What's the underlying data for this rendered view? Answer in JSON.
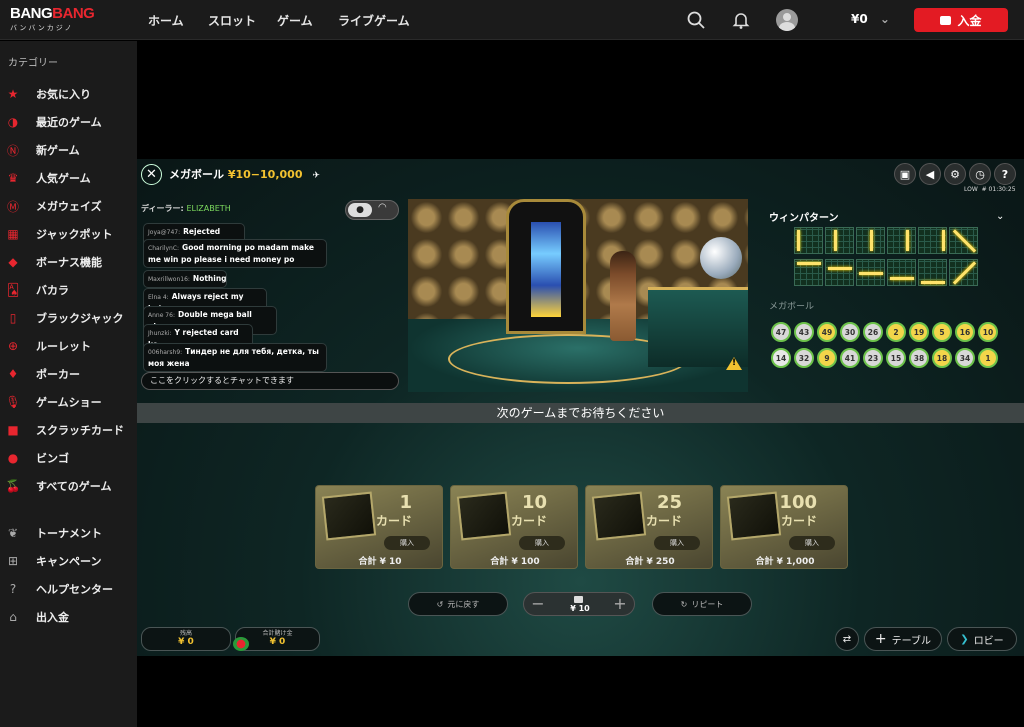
{
  "header": {
    "logo_line1_white": "BANG",
    "logo_line1_red": "BANG",
    "logo_line2": "バンバンカジノ",
    "nav": [
      "ホーム",
      "スロット",
      "ゲーム",
      "ライブゲーム"
    ],
    "balance": "¥0",
    "deposit_label": "入金"
  },
  "sidebar": {
    "category_title": "カテゴリー",
    "items": [
      {
        "label": "お気に入り",
        "icon": "star-icon"
      },
      {
        "label": "最近のゲーム",
        "icon": "recent-icon"
      },
      {
        "label": "新ゲーム",
        "icon": "new-icon"
      },
      {
        "label": "人気ゲーム",
        "icon": "crown-icon"
      },
      {
        "label": "メガウェイズ",
        "icon": "megaways-icon"
      },
      {
        "label": "ジャックポット",
        "icon": "jackpot-icon"
      },
      {
        "label": "ボーナス機能",
        "icon": "bonus-icon"
      },
      {
        "label": "バカラ",
        "icon": "baccarat-icon"
      },
      {
        "label": "ブラックジャック",
        "icon": "blackjack-icon"
      },
      {
        "label": "ルーレット",
        "icon": "roulette-icon"
      },
      {
        "label": "ポーカー",
        "icon": "poker-icon"
      },
      {
        "label": "ゲームショー",
        "icon": "microphone-icon"
      },
      {
        "label": "スクラッチカード",
        "icon": "scratch-icon"
      },
      {
        "label": "ビンゴ",
        "icon": "bingo-icon"
      },
      {
        "label": "すべてのゲーム",
        "icon": "cherry-icon"
      }
    ],
    "extra": [
      {
        "label": "トーナメント",
        "icon": "laurel-icon"
      },
      {
        "label": "キャンペーン",
        "icon": "gift-icon"
      },
      {
        "label": "ヘルプセンター",
        "icon": "help-icon"
      },
      {
        "label": "出入金",
        "icon": "wallet-icon"
      }
    ]
  },
  "game": {
    "title": "メガボール",
    "stake": "¥10−10,000",
    "status_low": "LOW",
    "time": "# 01:30:25",
    "dealer_label": "ディーラー:",
    "dealer_name": "ELIZABETH",
    "chat": [
      {
        "user": "Joya@747:",
        "text": "Rejected again"
      },
      {
        "user": "CharilynC:",
        "text": "Good morning po madam make me win po please i need money po"
      },
      {
        "user": "Maxrillwon16:",
        "text": "Nothing"
      },
      {
        "user": "Elna 4:",
        "text": "Always reject my bets..."
      },
      {
        "user": "Anne 76:",
        "text": "Double mega ball please"
      },
      {
        "user": "Jhunzki:",
        "text": "Y rejected card ko"
      },
      {
        "user": "006harsh9:",
        "text": "Тиндер не для тебя, детка, ты моя жена"
      }
    ],
    "chat_placeholder": "ここをクリックするとチャットできます",
    "win_pattern_title": "ウィンパターン",
    "megaball_label": "メガボール",
    "balls_row1": [
      "47",
      "43",
      "49",
      "30",
      "26",
      "2",
      "19",
      "5",
      "16",
      "10"
    ],
    "balls_row2": [
      "14",
      "32",
      "9",
      "41",
      "23",
      "15",
      "38",
      "18",
      "34",
      "1"
    ],
    "wait_banner": "次のゲームまでお待ちください",
    "cards": [
      {
        "num": "1",
        "label": "カード",
        "buy": "購入",
        "total": "合計 ¥ 10"
      },
      {
        "num": "10",
        "label": "カード",
        "buy": "購入",
        "total": "合計 ¥ 100"
      },
      {
        "num": "25",
        "label": "カード",
        "buy": "購入",
        "total": "合計 ¥ 250"
      },
      {
        "num": "100",
        "label": "カード",
        "buy": "購入",
        "total": "合計 ¥ 1,000"
      }
    ],
    "undo_label": "元に戻す",
    "stake_value": "¥ 10",
    "repeat_label": "リピート",
    "balance_label": "残高",
    "balance_value": "¥ 0",
    "bet_label": "合計賭け金",
    "bet_value": "¥ 0",
    "table_label": "テーブル",
    "lobby_label": "ロビー"
  }
}
